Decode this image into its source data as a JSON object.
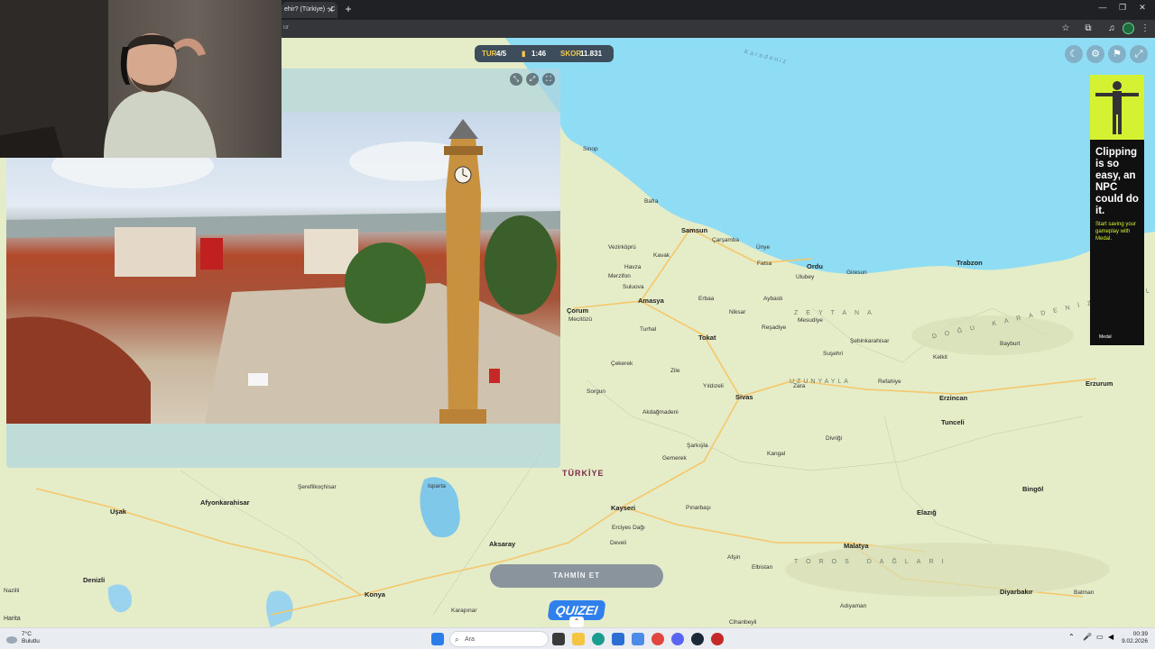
{
  "browser": {
    "tab_title": "ehir? (Türkiye) - C",
    "tab_close": "✕",
    "new_tab": "+",
    "url_fragment": "ur",
    "window_controls": [
      "—",
      "❐",
      "✕"
    ]
  },
  "hud": {
    "round_label": "TUR",
    "round_value": "4/5",
    "time_value": "1:46",
    "score_label": "SKOR",
    "score_value": "11.831"
  },
  "map": {
    "sea_label": "Karadeniz",
    "country_label": "TÜRKİYE",
    "credit": "Harita",
    "region_labels": [
      "ZEYTANA",
      "DOĞU KARADENİZ DAĞLARI",
      "UZUNYAYLA",
      "TOROS DAĞLARI"
    ],
    "cities": [
      {
        "name": "Sinop",
        "major": false
      },
      {
        "name": "Bafra",
        "major": false
      },
      {
        "name": "Samsun",
        "major": true
      },
      {
        "name": "Çarşamba",
        "major": false
      },
      {
        "name": "Ünye",
        "major": false
      },
      {
        "name": "Fatsa",
        "major": false
      },
      {
        "name": "Ordu",
        "major": true
      },
      {
        "name": "Giresun",
        "major": false
      },
      {
        "name": "Trabzon",
        "major": true
      },
      {
        "name": "Vezirköprü",
        "major": false
      },
      {
        "name": "Kavak",
        "major": false
      },
      {
        "name": "Havza",
        "major": false
      },
      {
        "name": "Merzifon",
        "major": false
      },
      {
        "name": "Suluova",
        "major": false
      },
      {
        "name": "Amasya",
        "major": true
      },
      {
        "name": "Erbaa",
        "major": false
      },
      {
        "name": "Niksar",
        "major": false
      },
      {
        "name": "Ulubey",
        "major": false
      },
      {
        "name": "Aybastı",
        "major": false
      },
      {
        "name": "Çorum",
        "major": true
      },
      {
        "name": "Mecitözü",
        "major": false
      },
      {
        "name": "Turhal",
        "major": false
      },
      {
        "name": "Tokat",
        "major": true
      },
      {
        "name": "Reşadiye",
        "major": false
      },
      {
        "name": "Mesudiye",
        "major": false
      },
      {
        "name": "Şebinkarahisar",
        "major": false
      },
      {
        "name": "Bayburt",
        "major": false
      },
      {
        "name": "Zile",
        "major": false
      },
      {
        "name": "Çekerek",
        "major": false
      },
      {
        "name": "Yıldızeli",
        "major": false
      },
      {
        "name": "Sivas",
        "major": true
      },
      {
        "name": "Suşehri",
        "major": false
      },
      {
        "name": "Kelkit",
        "major": false
      },
      {
        "name": "Refahiye",
        "major": false
      },
      {
        "name": "Erzincan",
        "major": true
      },
      {
        "name": "Erzurum",
        "major": true
      },
      {
        "name": "Sorgun",
        "major": false
      },
      {
        "name": "Akdağmadeni",
        "major": false
      },
      {
        "name": "Zara",
        "major": false
      },
      {
        "name": "Divriği",
        "major": false
      },
      {
        "name": "Şarkışla",
        "major": false
      },
      {
        "name": "Gemerek",
        "major": false
      },
      {
        "name": "Kangal",
        "major": false
      },
      {
        "name": "Tunceli",
        "major": true
      },
      {
        "name": "Bingöl",
        "major": true
      },
      {
        "name": "Kayseri",
        "major": true
      },
      {
        "name": "Erciyes Dağı",
        "major": false
      },
      {
        "name": "Develi",
        "major": false
      },
      {
        "name": "Pınarbaşı",
        "major": false
      },
      {
        "name": "Malatya",
        "major": true
      },
      {
        "name": "Elazığ",
        "major": true
      },
      {
        "name": "Afşin",
        "major": false
      },
      {
        "name": "Elbistan",
        "major": false
      },
      {
        "name": "Adıyaman",
        "major": false
      },
      {
        "name": "Diyarbakır",
        "major": true
      },
      {
        "name": "Batman",
        "major": false
      },
      {
        "name": "Afyonkarahisar",
        "major": true
      },
      {
        "name": "Uşak",
        "major": true
      },
      {
        "name": "Konya",
        "major": true
      },
      {
        "name": "Aksaray",
        "major": true
      },
      {
        "name": "Karapınar",
        "major": false
      },
      {
        "name": "Denizli",
        "major": true
      },
      {
        "name": "Nazilli",
        "major": false
      },
      {
        "name": "Isparta",
        "major": false
      },
      {
        "name": "Şereflikoçhisar",
        "major": false
      },
      {
        "name": "Cihanbeyli",
        "major": false
      },
      {
        "name": "Kahramanmaraş",
        "major": false
      }
    ]
  },
  "guess_button": "TAHMİN ET",
  "logo_text": "QUIZEI",
  "ad": {
    "headline": "Clipping is so easy, an NPC could do it.",
    "subline": "Start saving your gameplay with Medal.",
    "brand": "Medal"
  },
  "taskbar": {
    "weather_temp": "7°C",
    "weather_desc": "Bulutlu",
    "search_placeholder": "Ara",
    "time": "00:39",
    "date": "9.02.2026"
  },
  "colors": {
    "sea": "#8fdcf5",
    "land": "#e5ecc8",
    "hud_bg": "#3e4d5c",
    "hud_accent": "#f2c94c",
    "ad_accent": "#d4f232"
  }
}
